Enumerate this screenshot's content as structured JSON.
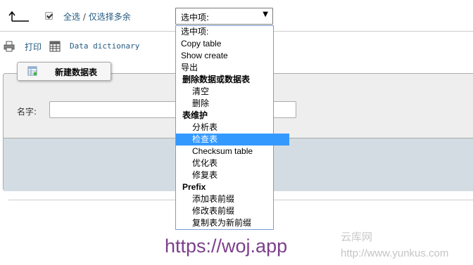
{
  "toolbar": {
    "select_all": "全选",
    "separator": " / ",
    "select_multiple": "仅选择多余",
    "with_selected_value": "选中项:"
  },
  "dropdown": {
    "items": [
      {
        "label": "选中项:",
        "kind": "l0"
      },
      {
        "label": "Copy table",
        "kind": "l0"
      },
      {
        "label": "Show create",
        "kind": "l0"
      },
      {
        "label": "导出",
        "kind": "l0"
      },
      {
        "label": "删除数据或数据表",
        "kind": "grp"
      },
      {
        "label": "清空",
        "kind": "l1"
      },
      {
        "label": "删除",
        "kind": "l1"
      },
      {
        "label": "表维护",
        "kind": "grp"
      },
      {
        "label": "分析表",
        "kind": "l1"
      },
      {
        "label": "检查表",
        "kind": "l1",
        "selected": true
      },
      {
        "label": "Checksum table",
        "kind": "l1"
      },
      {
        "label": "优化表",
        "kind": "l1"
      },
      {
        "label": "修复表",
        "kind": "l1"
      },
      {
        "label": "Prefix",
        "kind": "grp"
      },
      {
        "label": "添加表前缀",
        "kind": "l1"
      },
      {
        "label": "修改表前缀",
        "kind": "l1"
      },
      {
        "label": "复制表为新前缀",
        "kind": "l1"
      }
    ]
  },
  "actions": {
    "print": "打印",
    "data_dictionary": "Data dictionary"
  },
  "create_table": {
    "title": "新建数据表",
    "name_label": "名字:"
  },
  "watermarks": {
    "yunku_cn": "云库网",
    "yunku_url": "http://www.yunkus.com",
    "woj": "https://woj.app"
  },
  "colors": {
    "link": "#235a81",
    "selection": "#3399ff",
    "panel_bg": "#eeeeee",
    "panel_footer": "#d3dce3"
  }
}
